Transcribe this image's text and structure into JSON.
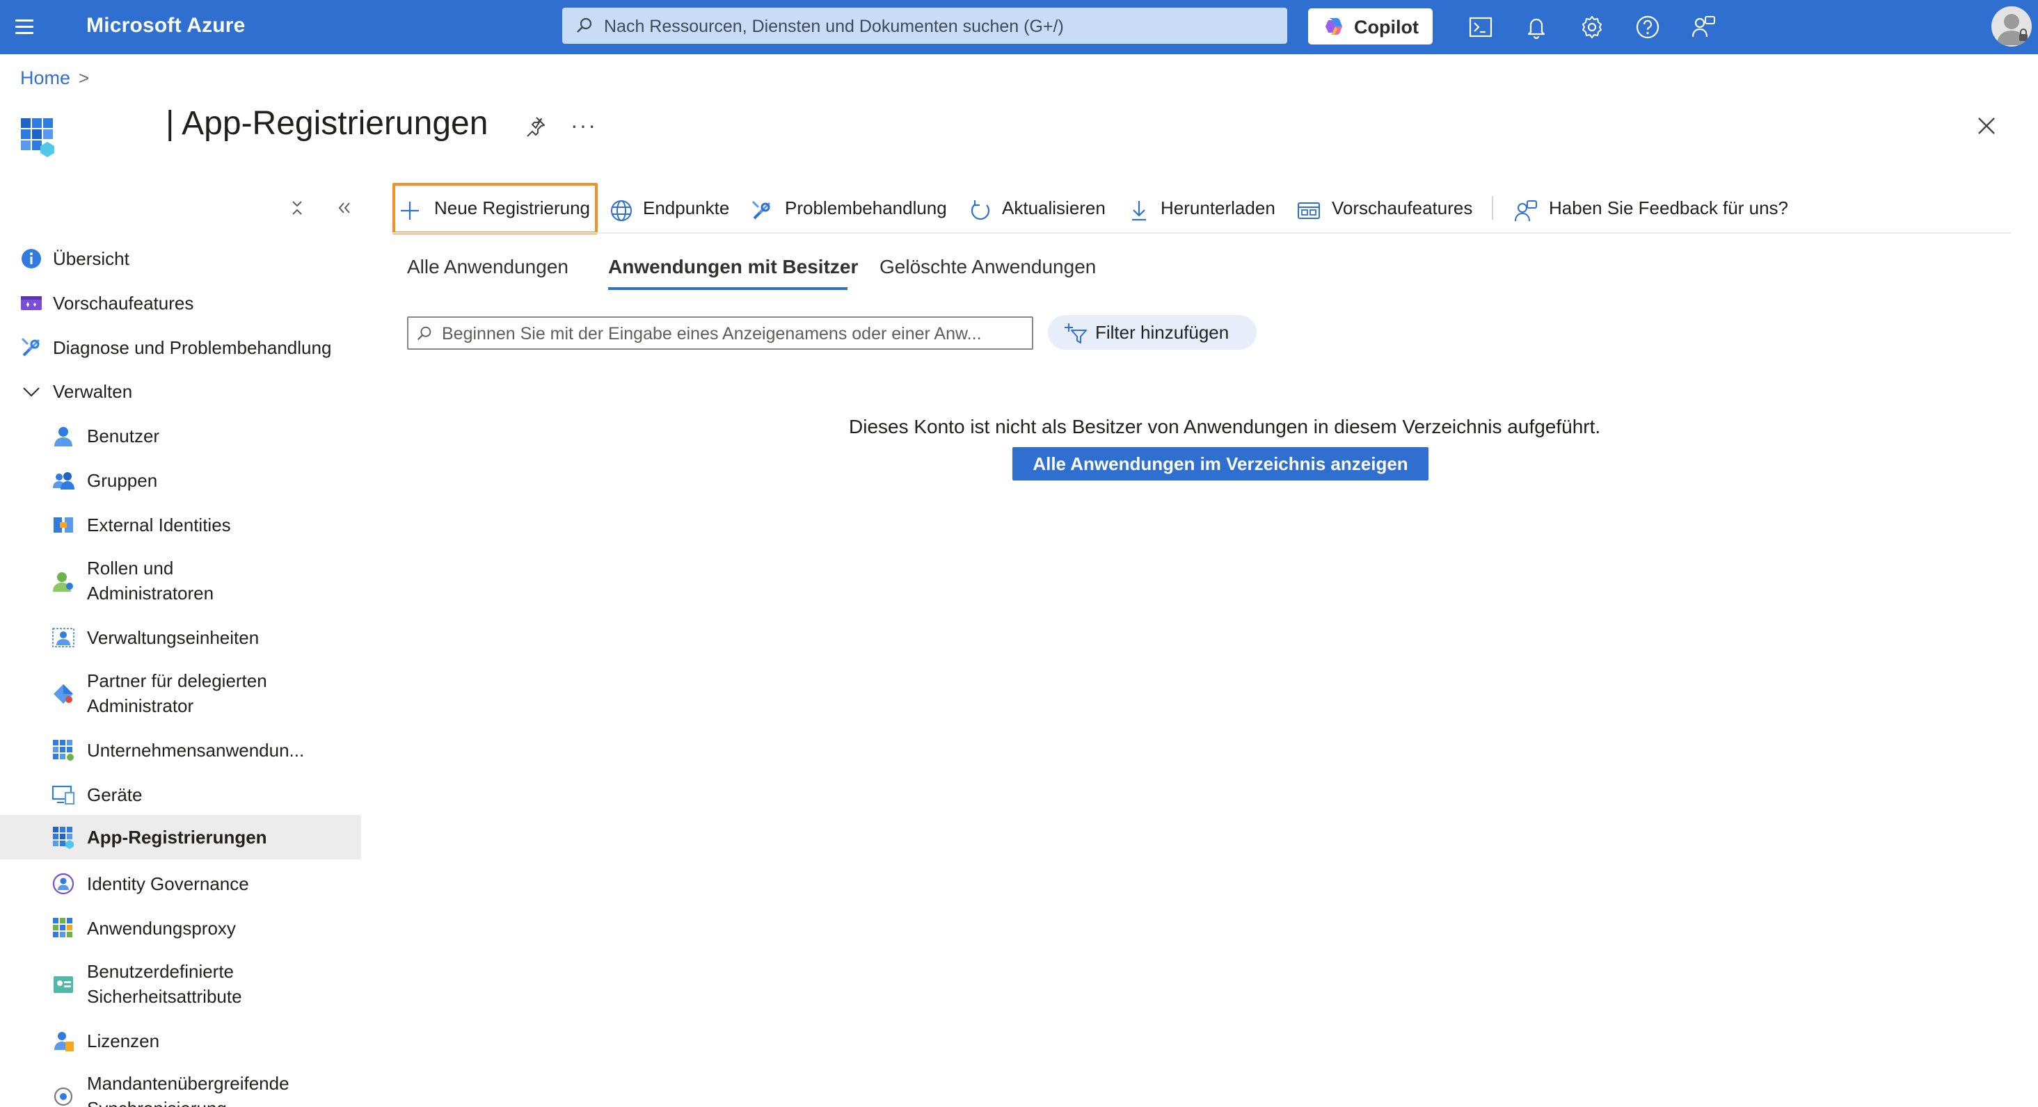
{
  "topbar": {
    "brand": "Microsoft Azure",
    "search_placeholder": "Nach Ressourcen, Diensten und Dokumenten suchen (G+/)",
    "copilot_label": "Copilot",
    "accent": "#2f6fd0"
  },
  "breadcrumb": {
    "home": "Home",
    "separator": ">"
  },
  "page": {
    "title": "| App-Registrierungen",
    "more": "···"
  },
  "sidebar": {
    "items": [
      {
        "label": "Übersicht",
        "icon": "info-icon"
      },
      {
        "label": "Vorschaufeatures",
        "icon": "preview-features-icon"
      },
      {
        "label": "Diagnose und Problembehandlung",
        "icon": "wrench-icon"
      },
      {
        "label": "Verwalten",
        "icon": "chevron-down-icon"
      },
      {
        "label": "Benutzer",
        "icon": "user-icon"
      },
      {
        "label": "Gruppen",
        "icon": "groups-icon"
      },
      {
        "label": "External Identities",
        "icon": "external-identities-icon"
      },
      {
        "label": "Rollen und Administratoren",
        "icon": "roles-icon"
      },
      {
        "label": "Verwaltungseinheiten",
        "icon": "admin-units-icon"
      },
      {
        "label": "Partner für delegierten Administrator",
        "icon": "partner-icon"
      },
      {
        "label": "Unternehmensanwendun...",
        "icon": "enterprise-apps-icon"
      },
      {
        "label": "Geräte",
        "icon": "devices-icon"
      },
      {
        "label": "App-Registrierungen",
        "icon": "app-registrations-icon"
      },
      {
        "label": "Identity Governance",
        "icon": "identity-governance-icon"
      },
      {
        "label": "Anwendungsproxy",
        "icon": "app-proxy-icon"
      },
      {
        "label": "Benutzerdefinierte Sicherheitsattribute",
        "icon": "security-attributes-icon"
      },
      {
        "label": "Lizenzen",
        "icon": "licenses-icon"
      },
      {
        "label": "Mandantenübergreifende Synchronisierung",
        "icon": "sync-icon"
      }
    ]
  },
  "toolbar": {
    "new_registration": "Neue Registrierung",
    "endpoints": "Endpunkte",
    "troubleshooting": "Problembehandlung",
    "refresh": "Aktualisieren",
    "download": "Herunterladen",
    "preview_features": "Vorschaufeatures",
    "feedback": "Haben Sie Feedback für uns?"
  },
  "tabs": {
    "all": "Alle Anwendungen",
    "owned": "Anwendungen mit Besitzer",
    "deleted": "Gelöschte Anwendungen"
  },
  "filter": {
    "placeholder": "Beginnen Sie mit der Eingabe eines Anzeigenamens oder einer Anw...",
    "add_filter": "Filter hinzufügen"
  },
  "empty_state": {
    "message": "Dieses Konto ist nicht als Besitzer von Anwendungen in diesem Verzeichnis aufgeführt.",
    "button": "Alle Anwendungen im Verzeichnis anzeigen"
  }
}
